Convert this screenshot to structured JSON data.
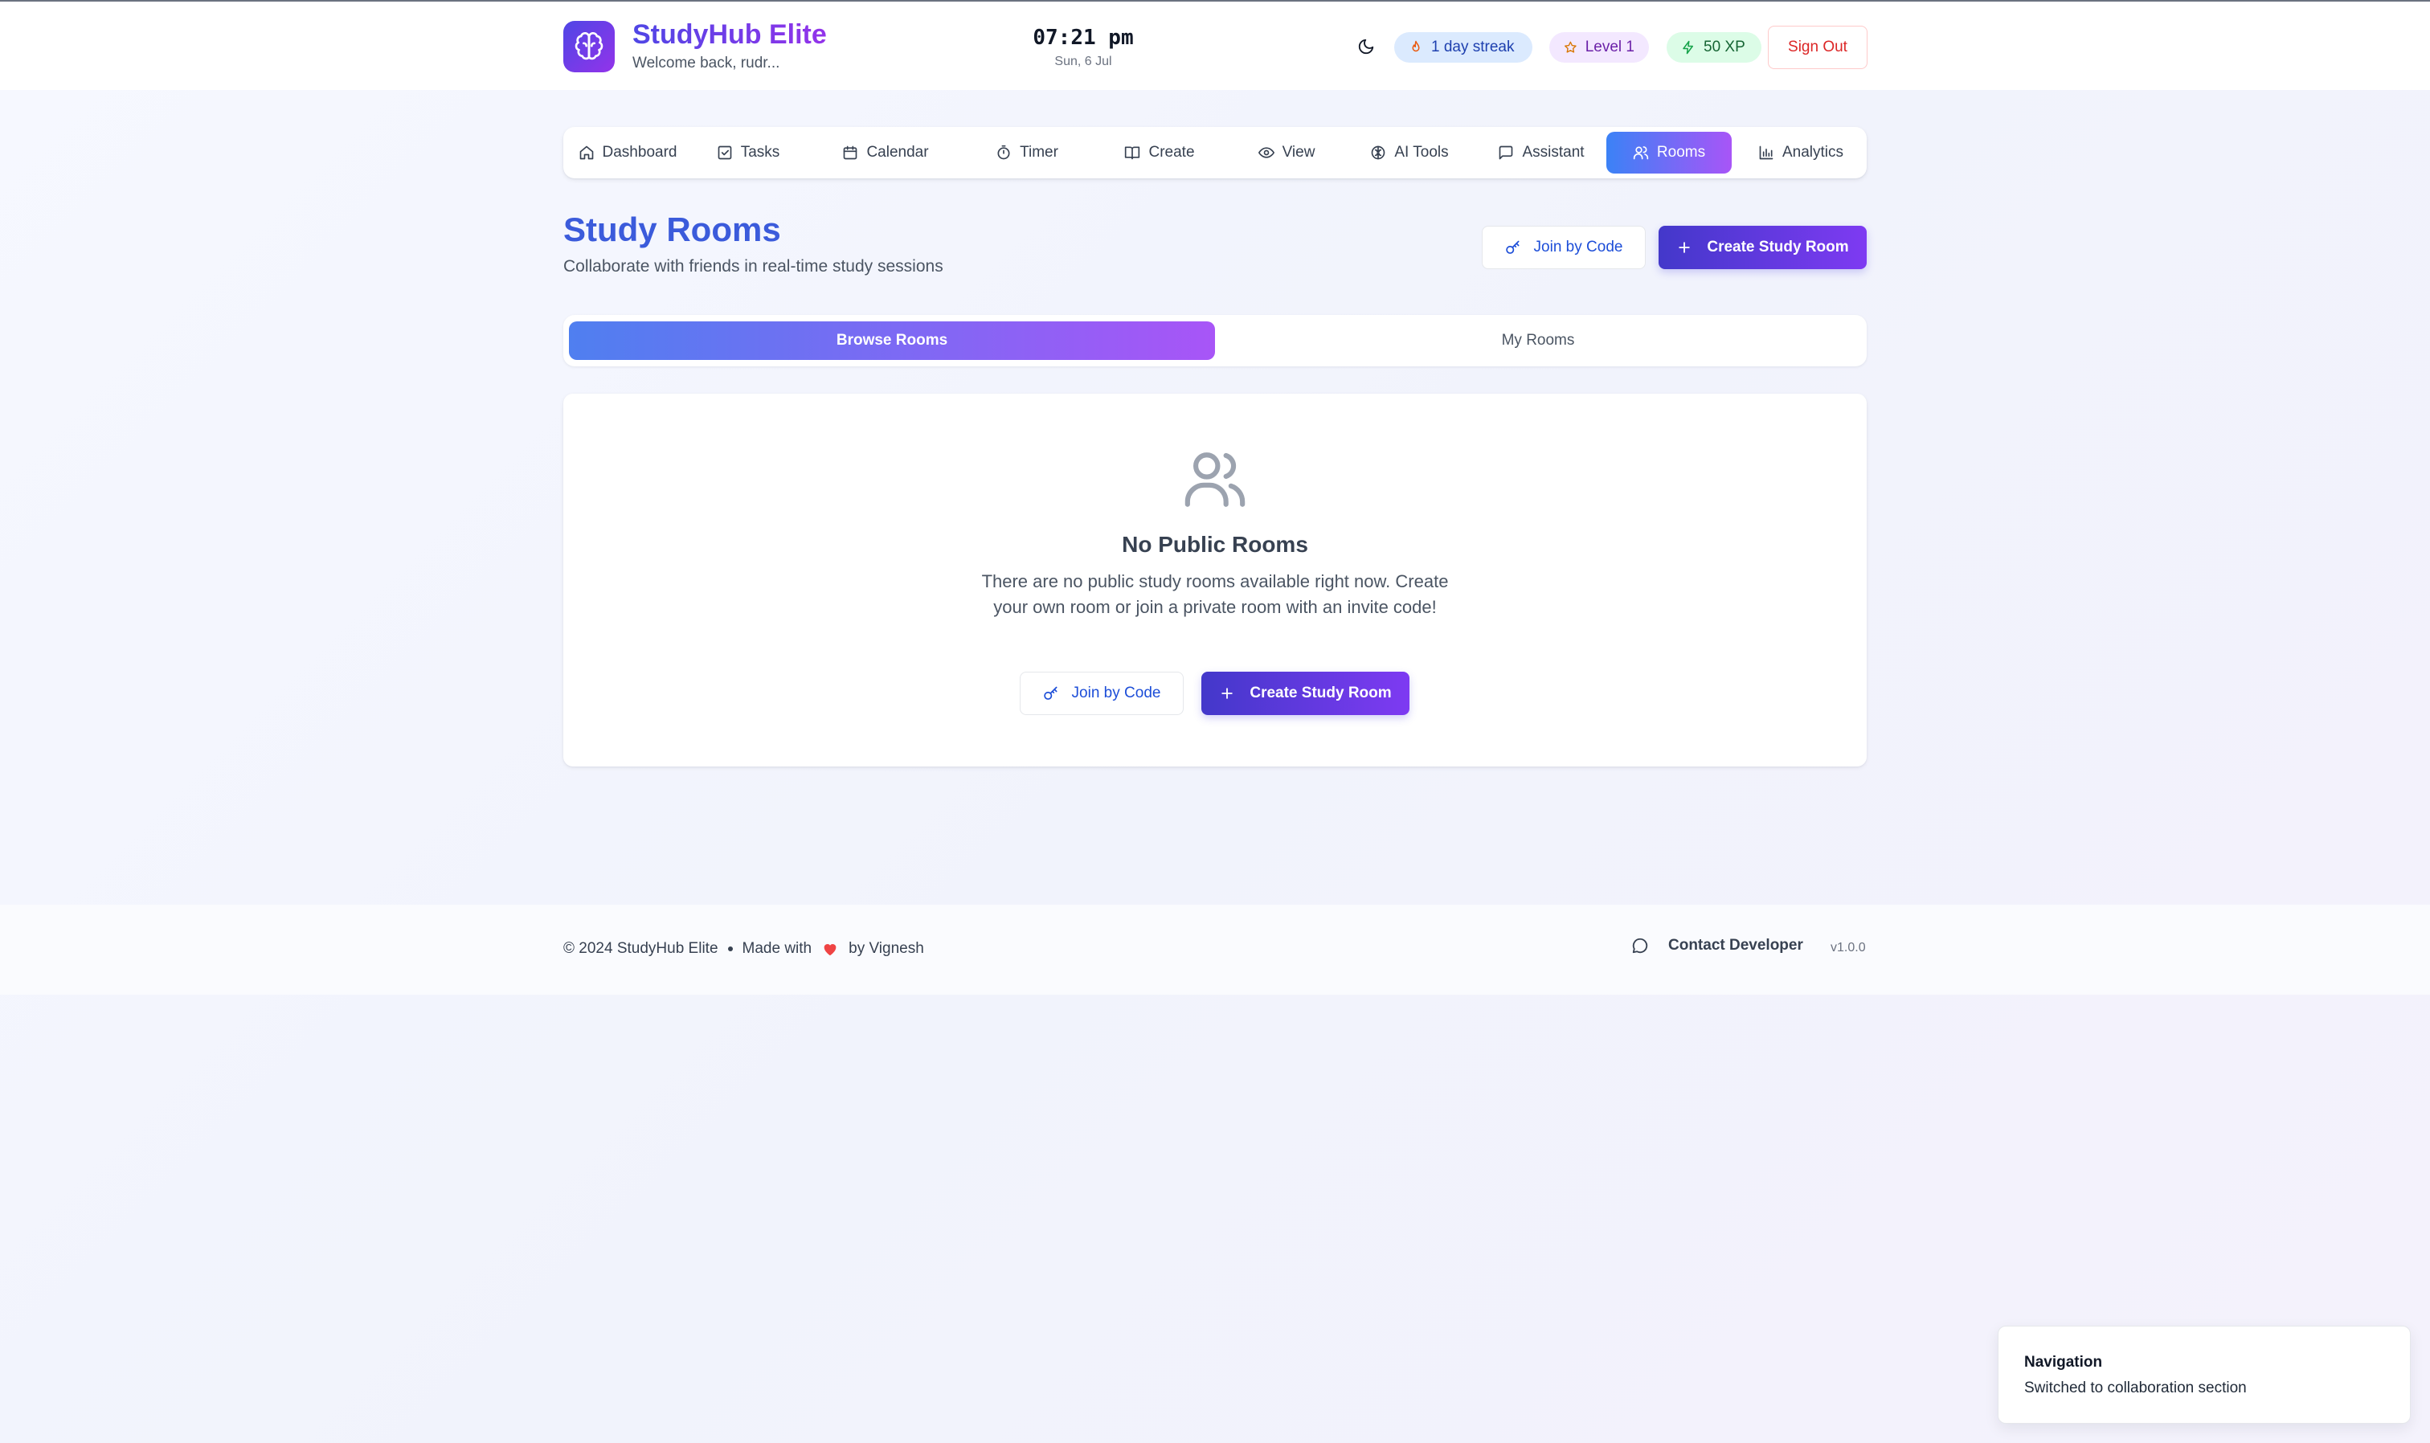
{
  "header": {
    "brand": "StudyHub Elite",
    "welcome": "Welcome back, rudr...",
    "time": "07:21 pm",
    "date": "Sun, 6 Jul",
    "streak": "1 day streak",
    "level": "Level 1",
    "xp": "50 XP",
    "sign_out": "Sign Out",
    "theme_icon": "moon-icon",
    "logo_icon": "brain-icon"
  },
  "nav": {
    "items": [
      {
        "label": "Dashboard",
        "icon": "home-icon"
      },
      {
        "label": "Tasks",
        "icon": "checkbox-icon"
      },
      {
        "label": "Calendar",
        "icon": "calendar-icon"
      },
      {
        "label": "Timer",
        "icon": "timer-icon"
      },
      {
        "label": "Create",
        "icon": "book-icon"
      },
      {
        "label": "View",
        "icon": "eye-icon"
      },
      {
        "label": "AI Tools",
        "icon": "brain-icon"
      },
      {
        "label": "Assistant",
        "icon": "chat-icon"
      },
      {
        "label": "Rooms",
        "icon": "users-icon"
      },
      {
        "label": "Analytics",
        "icon": "bar-chart-icon"
      }
    ],
    "active": "Rooms"
  },
  "page": {
    "title": "Study Rooms",
    "subtitle": "Collaborate with friends in real-time study sessions",
    "join_by_code": "Join by Code",
    "create_room": "Create Study Room"
  },
  "tabs": {
    "browse": "Browse Rooms",
    "mine": "My Rooms",
    "active": "Browse Rooms"
  },
  "empty_state": {
    "title": "No Public Rooms",
    "text": "There are no public study rooms available right now. Create your own room or join a private room with an invite code!",
    "join_by_code": "Join by Code",
    "create_room": "Create Study Room"
  },
  "footer": {
    "copyright": "© 2024 StudyHub Elite",
    "made_with": "Made with",
    "by": "by Vignesh",
    "contact": "Contact Developer",
    "version": "v1.0.0"
  },
  "toast": {
    "title": "Navigation",
    "text": "Switched to collaboration section"
  },
  "colors": {
    "accent": "#4f46e5",
    "accent_purple": "#9333ea",
    "title_blue": "#3b5bdb",
    "danger": "#dc2626"
  }
}
